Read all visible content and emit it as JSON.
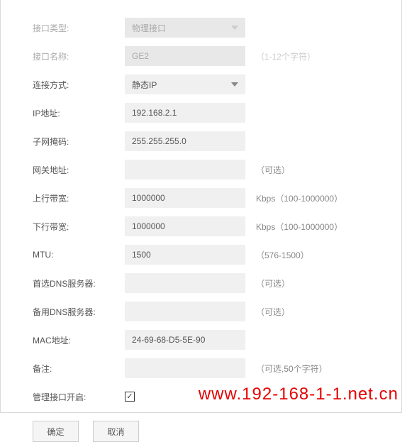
{
  "form": {
    "interface_type": {
      "label": "接口类型:",
      "value": "物理接口"
    },
    "interface_name": {
      "label": "接口名称:",
      "value": "GE2",
      "hint": "（1-12个字符）"
    },
    "connection_mode": {
      "label": "连接方式:",
      "value": "静态IP"
    },
    "ip_address": {
      "label": "IP地址:",
      "value": "192.168.2.1"
    },
    "subnet_mask": {
      "label": "子网掩码:",
      "value": "255.255.255.0"
    },
    "gateway": {
      "label": "网关地址:",
      "value": "",
      "hint": "（可选）"
    },
    "upstream": {
      "label": "上行带宽:",
      "value": "1000000",
      "hint": "Kbps（100-1000000）"
    },
    "downstream": {
      "label": "下行带宽:",
      "value": "1000000",
      "hint": "Kbps（100-1000000）"
    },
    "mtu": {
      "label": "MTU:",
      "value": "1500",
      "hint": "（576-1500）"
    },
    "primary_dns": {
      "label": "首选DNS服务器:",
      "value": "",
      "hint": "（可选）"
    },
    "backup_dns": {
      "label": "备用DNS服务器:",
      "value": "",
      "hint": "（可选）"
    },
    "mac_address": {
      "label": "MAC地址:",
      "value": "24-69-68-D5-5E-90"
    },
    "remark": {
      "label": "备注:",
      "value": "",
      "hint": "（可选,50个字符）"
    },
    "mgmt_enable": {
      "label": "管理接口开启:",
      "checked": true
    }
  },
  "buttons": {
    "ok": "确定",
    "cancel": "取消"
  },
  "watermark": "www.192-168-1-1.net.cn"
}
